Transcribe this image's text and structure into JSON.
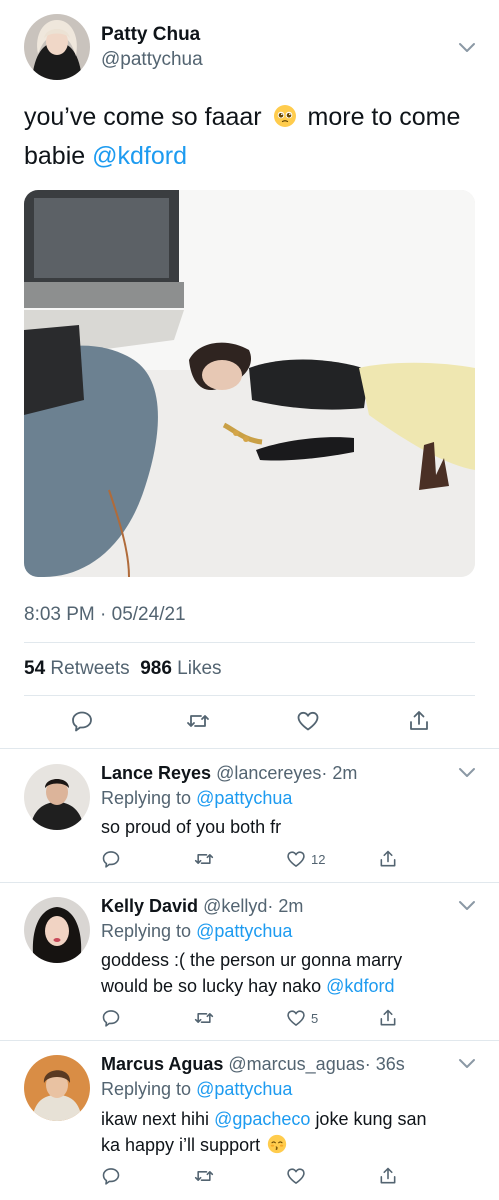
{
  "tweet": {
    "name": "Patty Chua",
    "handle": "@pattychua",
    "text_a": "you’ve come so faaar",
    "text_b": "more to come babie",
    "mention": "@kdford",
    "timestamp": "8:03 PM · 05/24/21",
    "retweets_count": "54",
    "retweets_label": "Retweets",
    "likes_count": "986",
    "likes_label": "Likes"
  },
  "icons": {
    "emoji": "pleading-face-icon",
    "reply": "reply-icon",
    "retweet": "retweet-icon",
    "like": "heart-icon",
    "share": "share-icon",
    "more": "chevron-down-icon"
  },
  "replies": [
    {
      "name": "Lance Reyes",
      "handle": "@lancereyes",
      "time": "· 2m",
      "replying_to_label": "Replying to",
      "replying_to": "@pattychua",
      "text": "so proud of you both fr",
      "like_count": "12"
    },
    {
      "name": "Kelly David",
      "handle": "@kellyd",
      "time": "· 2m",
      "replying_to_label": "Replying to",
      "replying_to": "@pattychua",
      "text_a": "goddess :( the person ur gonna marry",
      "text_b": "would be so lucky hay nako",
      "mention": "@kdford",
      "like_count": "5"
    },
    {
      "name": "Marcus Aguas",
      "handle": "@marcus_aguas",
      "time": "· 36s",
      "replying_to_label": "Replying to",
      "replying_to": "@pattychua",
      "text_a": "ikaw next hihi",
      "mention": "@gpacheco",
      "text_b": "joke kung san",
      "text_c": "ka happy i’ll support"
    }
  ],
  "colors": {
    "link": "#1d9bf0",
    "muted": "#536471",
    "divider": "#e1e8ed"
  }
}
